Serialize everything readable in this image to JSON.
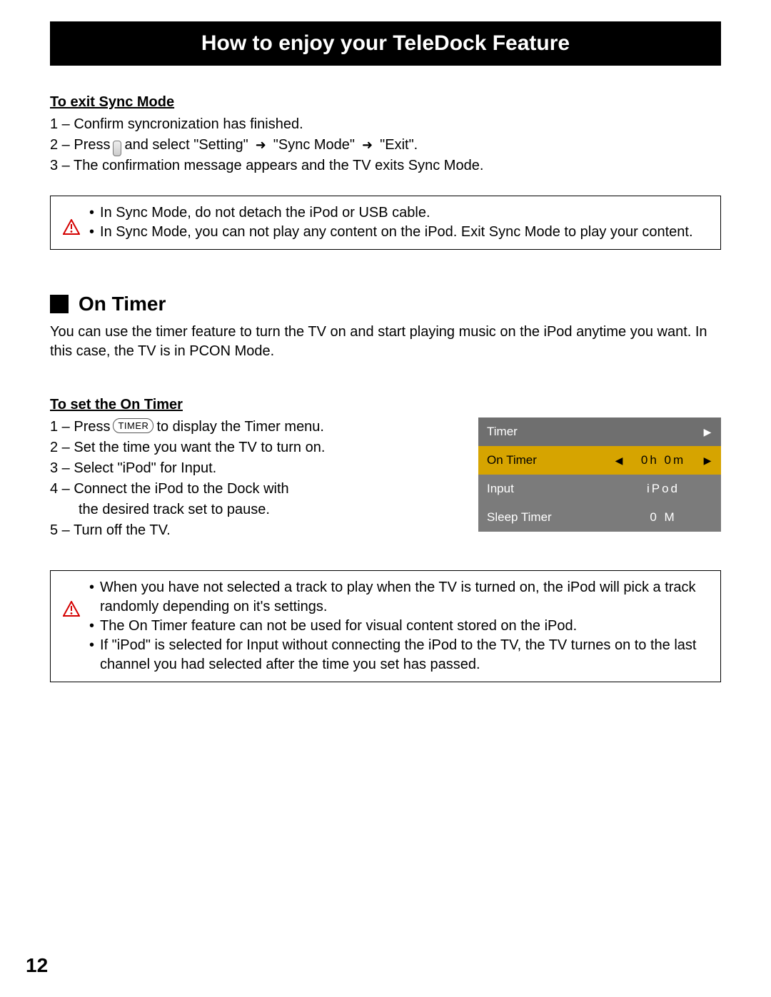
{
  "title": "How to enjoy your TeleDock Feature",
  "page_number": "12",
  "sync_exit": {
    "heading": "To exit Sync Mode",
    "step1": "1 – Confirm syncronization has finished.",
    "step2_pre": "2 – Press",
    "step2_mid": "and select \"Setting\"",
    "step2_sync": "\"Sync Mode\"",
    "step2_exit": "\"Exit\".",
    "step3": "3 – The confirmation message appears and the TV exits Sync Mode.",
    "warn1": "In Sync Mode, do not detach the iPod or USB cable.",
    "warn2": "In Sync Mode, you can not play any content on the iPod.  Exit Sync Mode to play your content."
  },
  "on_timer": {
    "heading": "On Timer",
    "intro": "You can use the timer feature to turn the TV on and start playing music on the iPod anytime you want.  In this case, the TV is in PCON Mode.",
    "set_heading": "To set the On Timer",
    "s1_pre": "1 – Press ",
    "s1_btn": "TIMER",
    "s1_post": " to display the Timer menu.",
    "s2": "2 – Set the time you want the TV to turn on.",
    "s3": "3 – Select \"iPod\" for Input.",
    "s4": "4 – Connect the iPod to the Dock with",
    "s4b": "the desired track set to pause.",
    "s5": "5 – Turn off the TV.",
    "warn1": "When you have not selected a track to play when the TV is turned on, the iPod will pick a track randomly depending on it's settings.",
    "warn2": "The On Timer feature can not be used for visual content stored on the iPod.",
    "warn3": "If \"iPod\" is selected for Input without connecting the iPod to the TV, the TV turnes on to the last channel you had selected after the time you set has passed."
  },
  "osd": {
    "header": "Timer",
    "row_on_label": "On Timer",
    "row_on_val": "0h    0m",
    "row_input_label": "Input",
    "row_input_val": "iPod",
    "row_sleep_label": "Sleep Timer",
    "row_sleep_val": "0   M"
  }
}
